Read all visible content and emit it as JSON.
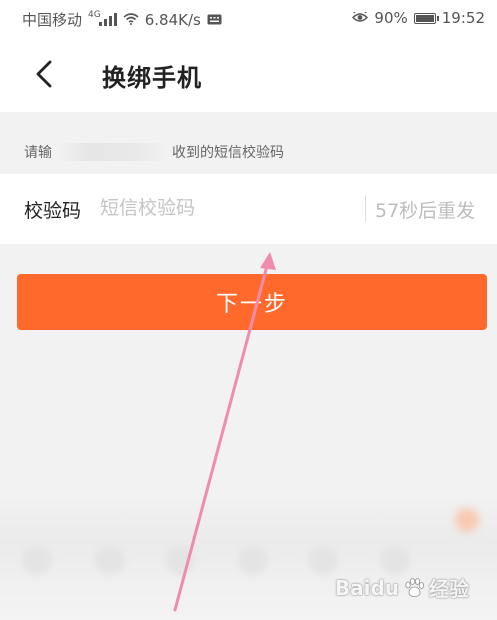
{
  "status_bar": {
    "carrier": "中国移动",
    "network_type": "4G",
    "speed": "6.84K/s",
    "battery": "90%",
    "battery_level": 0.9,
    "time": "19:52"
  },
  "header": {
    "title": "换绑手机"
  },
  "hint": {
    "prefix": "请输",
    "suffix": "收到的短信校验码"
  },
  "verification": {
    "label": "校验码",
    "placeholder": "短信校验码",
    "value": "",
    "resend_text": "57秒后重发"
  },
  "next_button": {
    "label": "下一步"
  },
  "watermark": {
    "brand": "Baidu",
    "suffix": "经验"
  },
  "colors": {
    "accent": "#ff6a2c",
    "annotation": "#f08bb0"
  }
}
